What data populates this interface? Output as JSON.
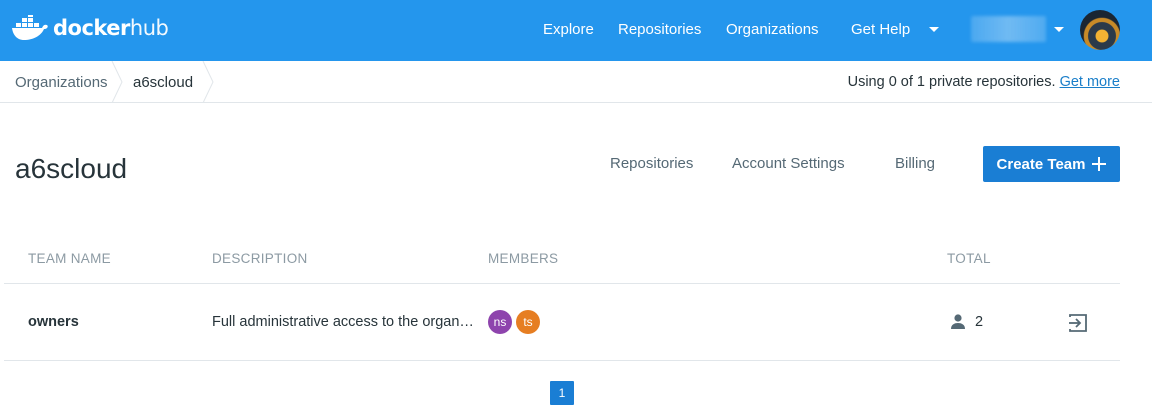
{
  "brand": {
    "logo_bold": "docker",
    "logo_light": "hub"
  },
  "nav": {
    "explore": "Explore",
    "repositories": "Repositories",
    "organizations": "Organizations",
    "get_help": "Get Help"
  },
  "breadcrumb": {
    "items": [
      "Organizations",
      "a6scloud"
    ],
    "usage_text": "Using 0 of 1 private repositories.",
    "usage_link": "Get more"
  },
  "org": {
    "name": "a6scloud",
    "tabs": [
      "Repositories",
      "Account Settings",
      "Billing"
    ],
    "create_team_label": "Create Team"
  },
  "table": {
    "headers": {
      "team_name": "TEAM NAME",
      "description": "DESCRIPTION",
      "members": "MEMBERS",
      "total": "TOTAL"
    },
    "rows": [
      {
        "team_name": "owners",
        "description": "Full administrative access to the organization",
        "members": [
          {
            "initials": "ns",
            "color": "#8e44ad"
          },
          {
            "initials": "ts",
            "color": "#e67e22"
          }
        ],
        "total": "2"
      }
    ]
  },
  "pagination": {
    "current": "1"
  },
  "colors": {
    "header": "#2496ed",
    "primary": "#1a7ed4",
    "link": "#1a7ec9"
  }
}
